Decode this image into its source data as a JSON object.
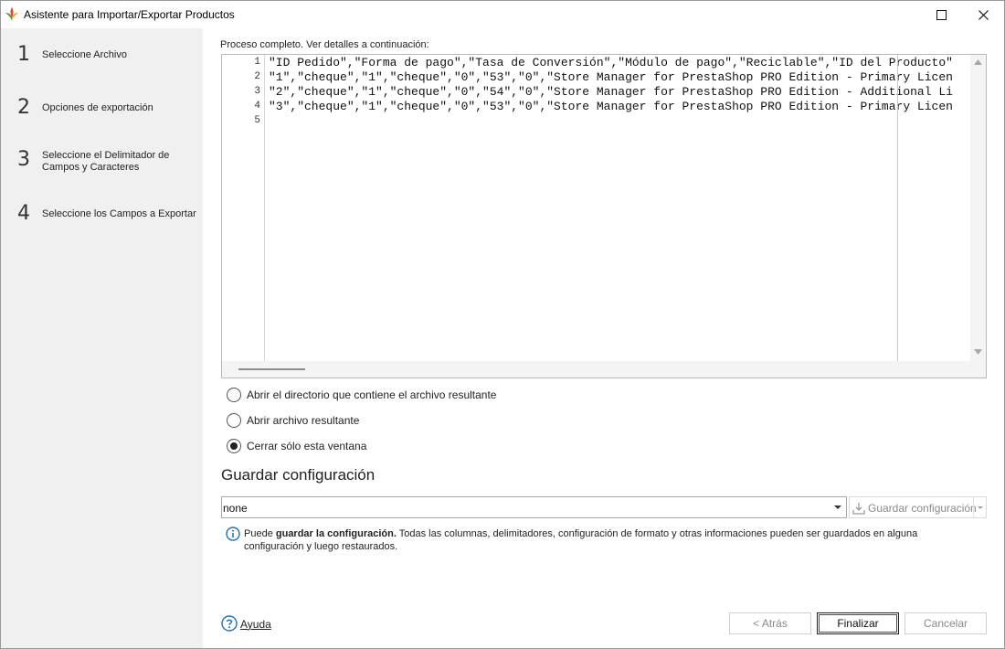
{
  "window": {
    "title": "Asistente para Importar/Exportar Productos"
  },
  "sidebar": {
    "steps": [
      {
        "number": "1",
        "label": "Seleccione Archivo"
      },
      {
        "number": "2",
        "label": "Opciones de exportación"
      },
      {
        "number": "3",
        "label_line1": "Seleccione el Delimitador de",
        "label_line2": "Campos y Caracteres"
      },
      {
        "number": "4",
        "label": "Seleccione los Campos a Exportar"
      }
    ]
  },
  "main": {
    "status": "Proceso completo. Ver detalles a continuación:",
    "editor": {
      "line_numbers": [
        "1",
        "2",
        "3",
        "4",
        "5"
      ],
      "lines": [
        "\"ID Pedido\",\"Forma de pago\",\"Tasa de Conversión\",\"Módulo de pago\",\"Reciclable\",\"ID del Producto\"",
        "\"1\",\"cheque\",\"1\",\"cheque\",\"0\",\"53\",\"0\",\"Store Manager for PrestaShop PRO Edition - Primary Licen",
        "\"2\",\"cheque\",\"1\",\"cheque\",\"0\",\"54\",\"0\",\"Store Manager for PrestaShop PRO Edition - Additional Li",
        "\"3\",\"cheque\",\"1\",\"cheque\",\"0\",\"53\",\"0\",\"Store Manager for PrestaShop PRO Edition - Primary Licen",
        ""
      ]
    },
    "options": [
      {
        "label": "Abrir el directorio que contiene el archivo resultante",
        "selected": false
      },
      {
        "label": "Abrir archivo resultante",
        "selected": false
      },
      {
        "label": "Cerrar sólo esta ventana",
        "selected": true
      }
    ],
    "config": {
      "section_title": "Guardar configuración",
      "value": "none",
      "save_button_label": "Guardar configuración"
    },
    "info": {
      "prefix": "Puede ",
      "bold": "guardar la configuración.",
      "rest": " Todas las columnas, delimitadores, configuración de formato y otras informaciones pueden ser guardados en alguna configuración y luego restaurados."
    }
  },
  "footer": {
    "help_label": "Ayuda",
    "back_label": "< Atrás",
    "finish_label": "Finalizar",
    "cancel_label": "Cancelar"
  },
  "colors": {
    "sidebar_bg": "#f0f0f0",
    "info_icon": "#1e73be",
    "help_icon": "#1e73be"
  }
}
